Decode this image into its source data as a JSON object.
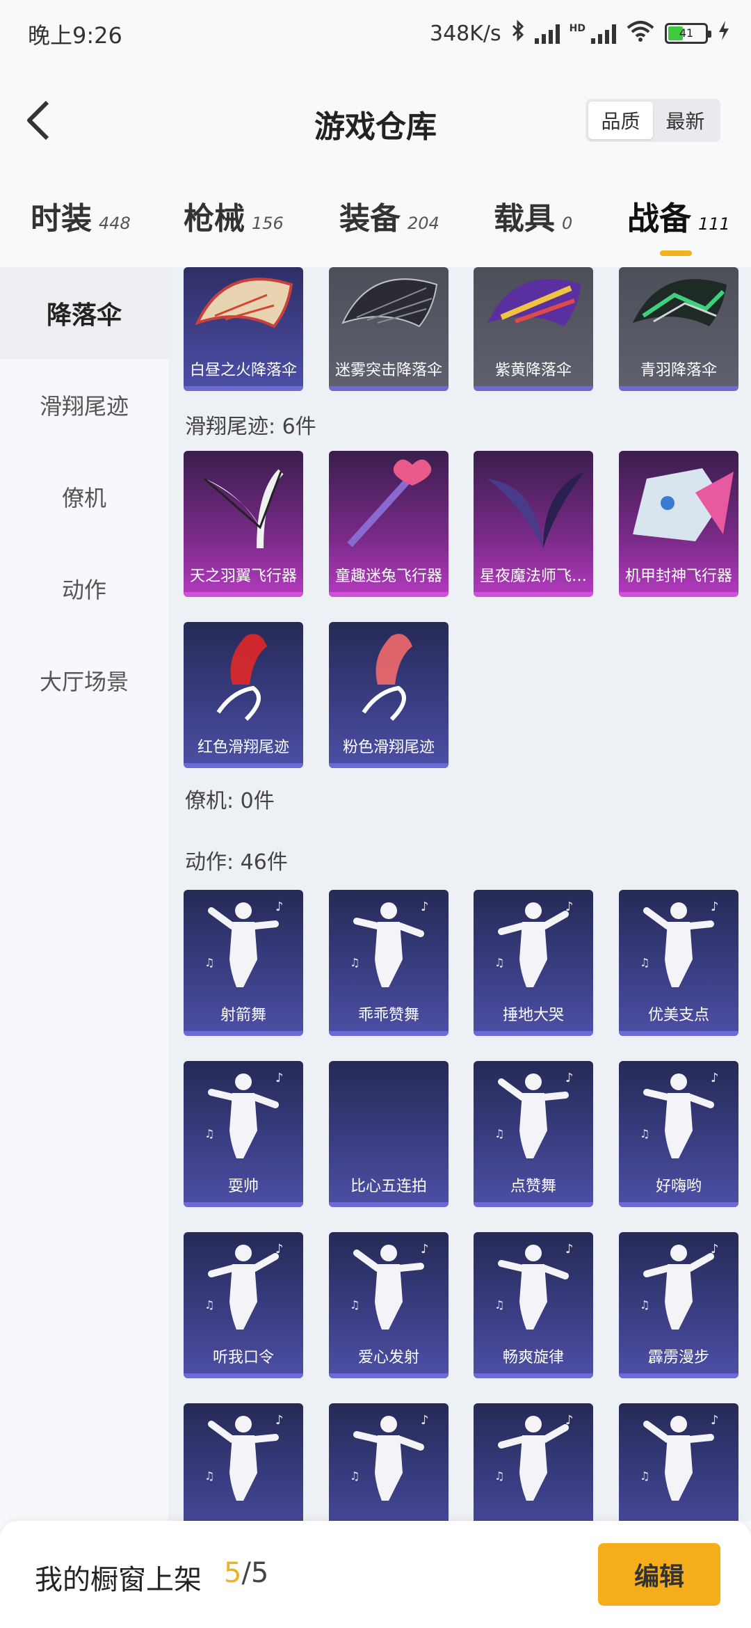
{
  "status": {
    "time": "晚上9:26",
    "network_speed": "348K/s",
    "battery": "41"
  },
  "header": {
    "back_icon": "chevron-left-icon",
    "title": "游戏仓库",
    "sort_options": [
      {
        "label": "品质",
        "active": true
      },
      {
        "label": "最新",
        "active": false
      }
    ]
  },
  "tabs": [
    {
      "label": "时装",
      "count": "448",
      "active": false
    },
    {
      "label": "枪械",
      "count": "156",
      "active": false
    },
    {
      "label": "装备",
      "count": "204",
      "active": false
    },
    {
      "label": "载具",
      "count": "0",
      "active": false
    },
    {
      "label": "战备",
      "count": "111",
      "active": true
    }
  ],
  "sidebar": {
    "items": [
      {
        "label": "降落伞",
        "active": true
      },
      {
        "label": "滑翔尾迹",
        "active": false
      },
      {
        "label": "僚机",
        "active": false
      },
      {
        "label": "动作",
        "active": false
      },
      {
        "label": "大厅场景",
        "active": false
      }
    ]
  },
  "sections": {
    "parachute_items": [
      {
        "name": "白昼之火降落伞",
        "style": "para-purple"
      },
      {
        "name": "迷雾突击降落伞",
        "style": "para-grey"
      },
      {
        "name": "紫黄降落伞",
        "style": "para-grey"
      },
      {
        "name": "青羽降落伞",
        "style": "para-grey"
      }
    ],
    "glide_label": "滑翔尾迹: 6件",
    "glide_items": [
      {
        "name": "天之羽翼飞行器",
        "style": "pink"
      },
      {
        "name": "童趣迷兔飞行器",
        "style": "pink"
      },
      {
        "name": "星夜魔法师飞…",
        "style": "pink"
      },
      {
        "name": "机甲封神飞行器",
        "style": "pink"
      },
      {
        "name": "红色滑翔尾迹",
        "style": "purple"
      },
      {
        "name": "粉色滑翔尾迹",
        "style": "purple"
      }
    ],
    "wingman_label": "僚机: 0件",
    "action_label": "动作: 46件",
    "action_items": [
      {
        "name": "射箭舞"
      },
      {
        "name": "乖乖赞舞"
      },
      {
        "name": "捶地大哭"
      },
      {
        "name": "优美支点"
      },
      {
        "name": "耍帅"
      },
      {
        "name": "比心五连拍"
      },
      {
        "name": "点赞舞"
      },
      {
        "name": "好嗨哟"
      },
      {
        "name": "听我口令"
      },
      {
        "name": "爱心发射"
      },
      {
        "name": "畅爽旋律"
      },
      {
        "name": "霹雳漫步"
      },
      {
        "name": ""
      },
      {
        "name": ""
      },
      {
        "name": ""
      },
      {
        "name": ""
      }
    ]
  },
  "bottom": {
    "label": "我的橱窗上架",
    "count_current": "5",
    "count_total": "/5",
    "edit_label": "编辑"
  },
  "colors": {
    "accent": "#f2b21d",
    "edit_button": "#f6ad1b",
    "purple_card": "#3c3f86",
    "pink_card": "#b43bc0",
    "purple_bar": "#6b6bd8",
    "pink_bar": "#d24fd8"
  }
}
